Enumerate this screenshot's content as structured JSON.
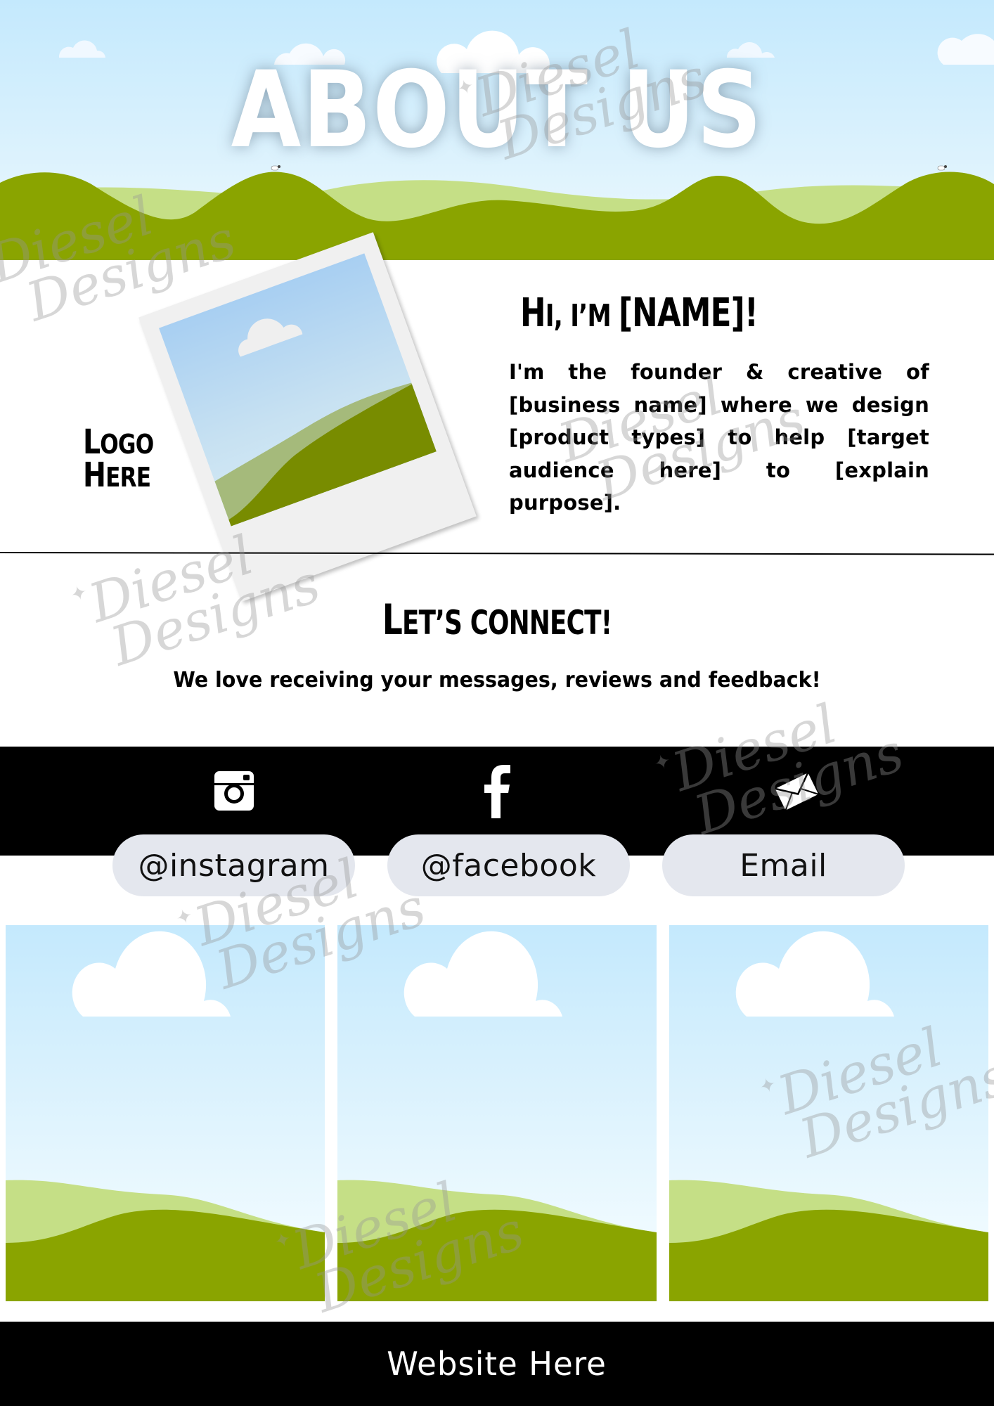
{
  "hero": {
    "title": "ABOUT US"
  },
  "intro": {
    "logo_line1_first": "L",
    "logo_line1_rest": "OGO",
    "logo_line2_first": "H",
    "logo_line2_rest": "ERE",
    "heading_first": "H",
    "heading_rest1": "I, I’M ",
    "heading_rest2": "[NAME]!",
    "body": "I'm the founder & creative of [business name] where we design [product types] to help [target audience here] to [explain purpose]."
  },
  "connect": {
    "heading_first": "L",
    "heading_rest": "ET’S CONNECT!",
    "subtitle": "We love receiving your messages, reviews and feedback!"
  },
  "social": [
    {
      "icon": "instagram-icon",
      "label": "@instagram"
    },
    {
      "icon": "facebook-icon",
      "label": "@facebook"
    },
    {
      "icon": "envelope-icon",
      "label": "Email"
    }
  ],
  "gallery": {
    "count": 3
  },
  "footer": {
    "website": "Website Here"
  },
  "watermark": {
    "line1": "Diesel",
    "line2": "Designs",
    "star": "✦"
  },
  "colors": {
    "sky_top": "#c4e9fd",
    "hill_dark": "#8aa400",
    "hill_light": "#c5df86",
    "pill_bg": "#e4e7ee",
    "bar_bg": "#000000"
  }
}
